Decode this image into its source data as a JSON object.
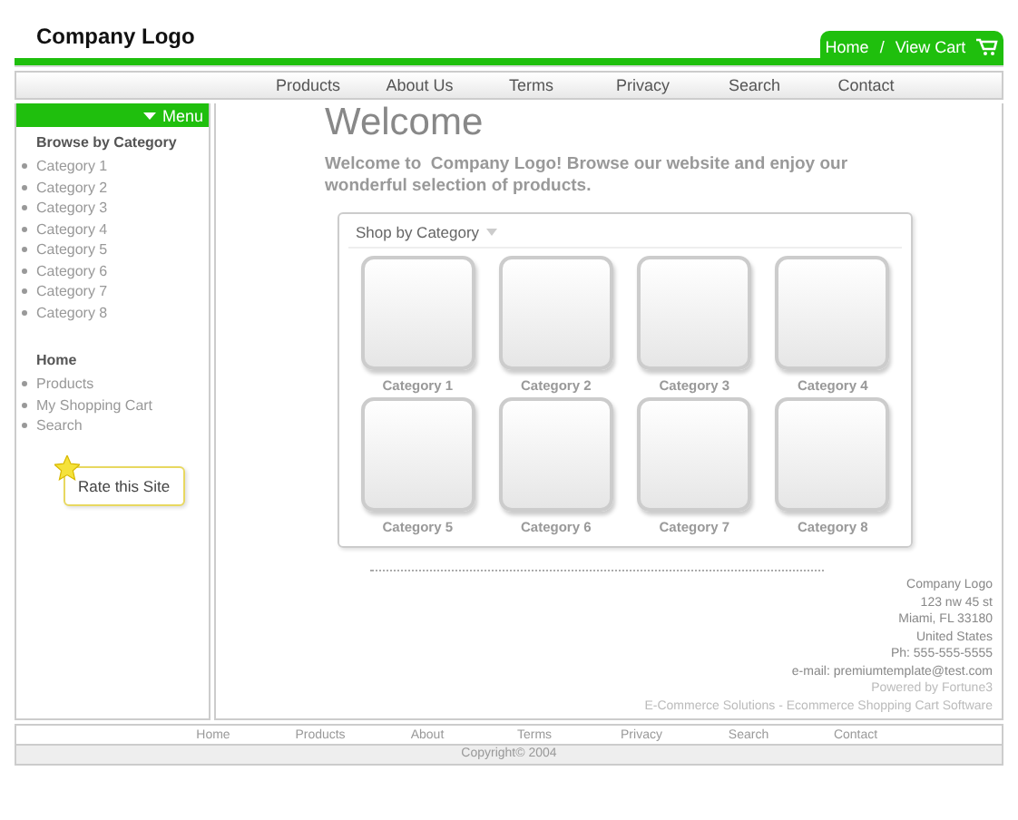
{
  "header": {
    "logo": "Company Logo",
    "tab_links": [
      "Home",
      "/",
      "View Cart"
    ]
  },
  "nav": [
    "Products",
    "About Us",
    "Terms",
    "Privacy",
    "Search",
    "Contact"
  ],
  "sidebar": {
    "menu_label": "Menu",
    "category_heading": "Browse by Category",
    "categories": [
      "Category 1",
      "Category 2",
      "Category 3",
      "Category 4",
      "Category 5",
      "Category 6",
      "Category 7",
      "Category 8"
    ],
    "home_heading": "Home",
    "links": [
      "Products",
      "My Shopping Cart",
      "Search"
    ],
    "rate_button": "Rate this Site"
  },
  "content": {
    "title": "Welcome",
    "intro": "Welcome to  Company Logo! Browse our website and enjoy our wonderful selection of products.",
    "shop_title": "Shop by Category",
    "tiles": [
      "Category 1",
      "Category 2",
      "Category 3",
      "Category 4",
      "Category 5",
      "Category 6",
      "Category 7",
      "Category 8"
    ],
    "address": [
      "Company Logo",
      "123 nw 45 st",
      "Miami, FL 33180",
      "United States",
      "Ph: 555-555-5555",
      "e-mail: premiumtemplate@test.com"
    ],
    "powered": [
      "Powered by Fortune3",
      "E-Commerce Solutions - Ecommerce Shopping Cart Software"
    ]
  },
  "footer": {
    "links": [
      "Home",
      "Products",
      "About",
      "Terms",
      "Privacy",
      "Search",
      "Contact"
    ],
    "copyright": "Copyright© 2004"
  }
}
